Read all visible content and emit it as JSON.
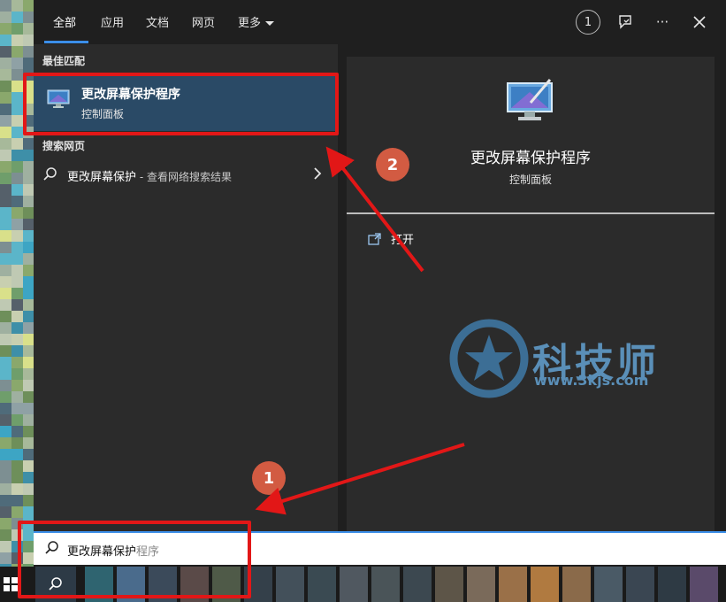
{
  "tabs": [
    {
      "label": "全部"
    },
    {
      "label": "应用"
    },
    {
      "label": "文档"
    },
    {
      "label": "网页"
    },
    {
      "label": "更多"
    }
  ],
  "topbar": {
    "badge_count": "1"
  },
  "sections": {
    "best_match": "最佳匹配",
    "search_web": "搜索网页"
  },
  "best_match": {
    "title": "更改屏幕保护程序",
    "subtitle": "控制面板"
  },
  "web_result": {
    "query": "更改屏幕保护",
    "hint": " - 查看网络搜索结果"
  },
  "preview": {
    "title": "更改屏幕保护程序",
    "subtitle": "控制面板",
    "open_label": "打开"
  },
  "watermark": {
    "name": "科技师",
    "url": "www.3kjs.com"
  },
  "search": {
    "typed": "更改屏幕保护",
    "suggestion": "程序"
  },
  "annotations": {
    "step1": "1",
    "step2": "2"
  },
  "colors": {
    "accent": "#3b8ee8",
    "highlight": "#2a4a66",
    "annotation_red": "#e21717",
    "badge_orange": "#d25b42"
  }
}
